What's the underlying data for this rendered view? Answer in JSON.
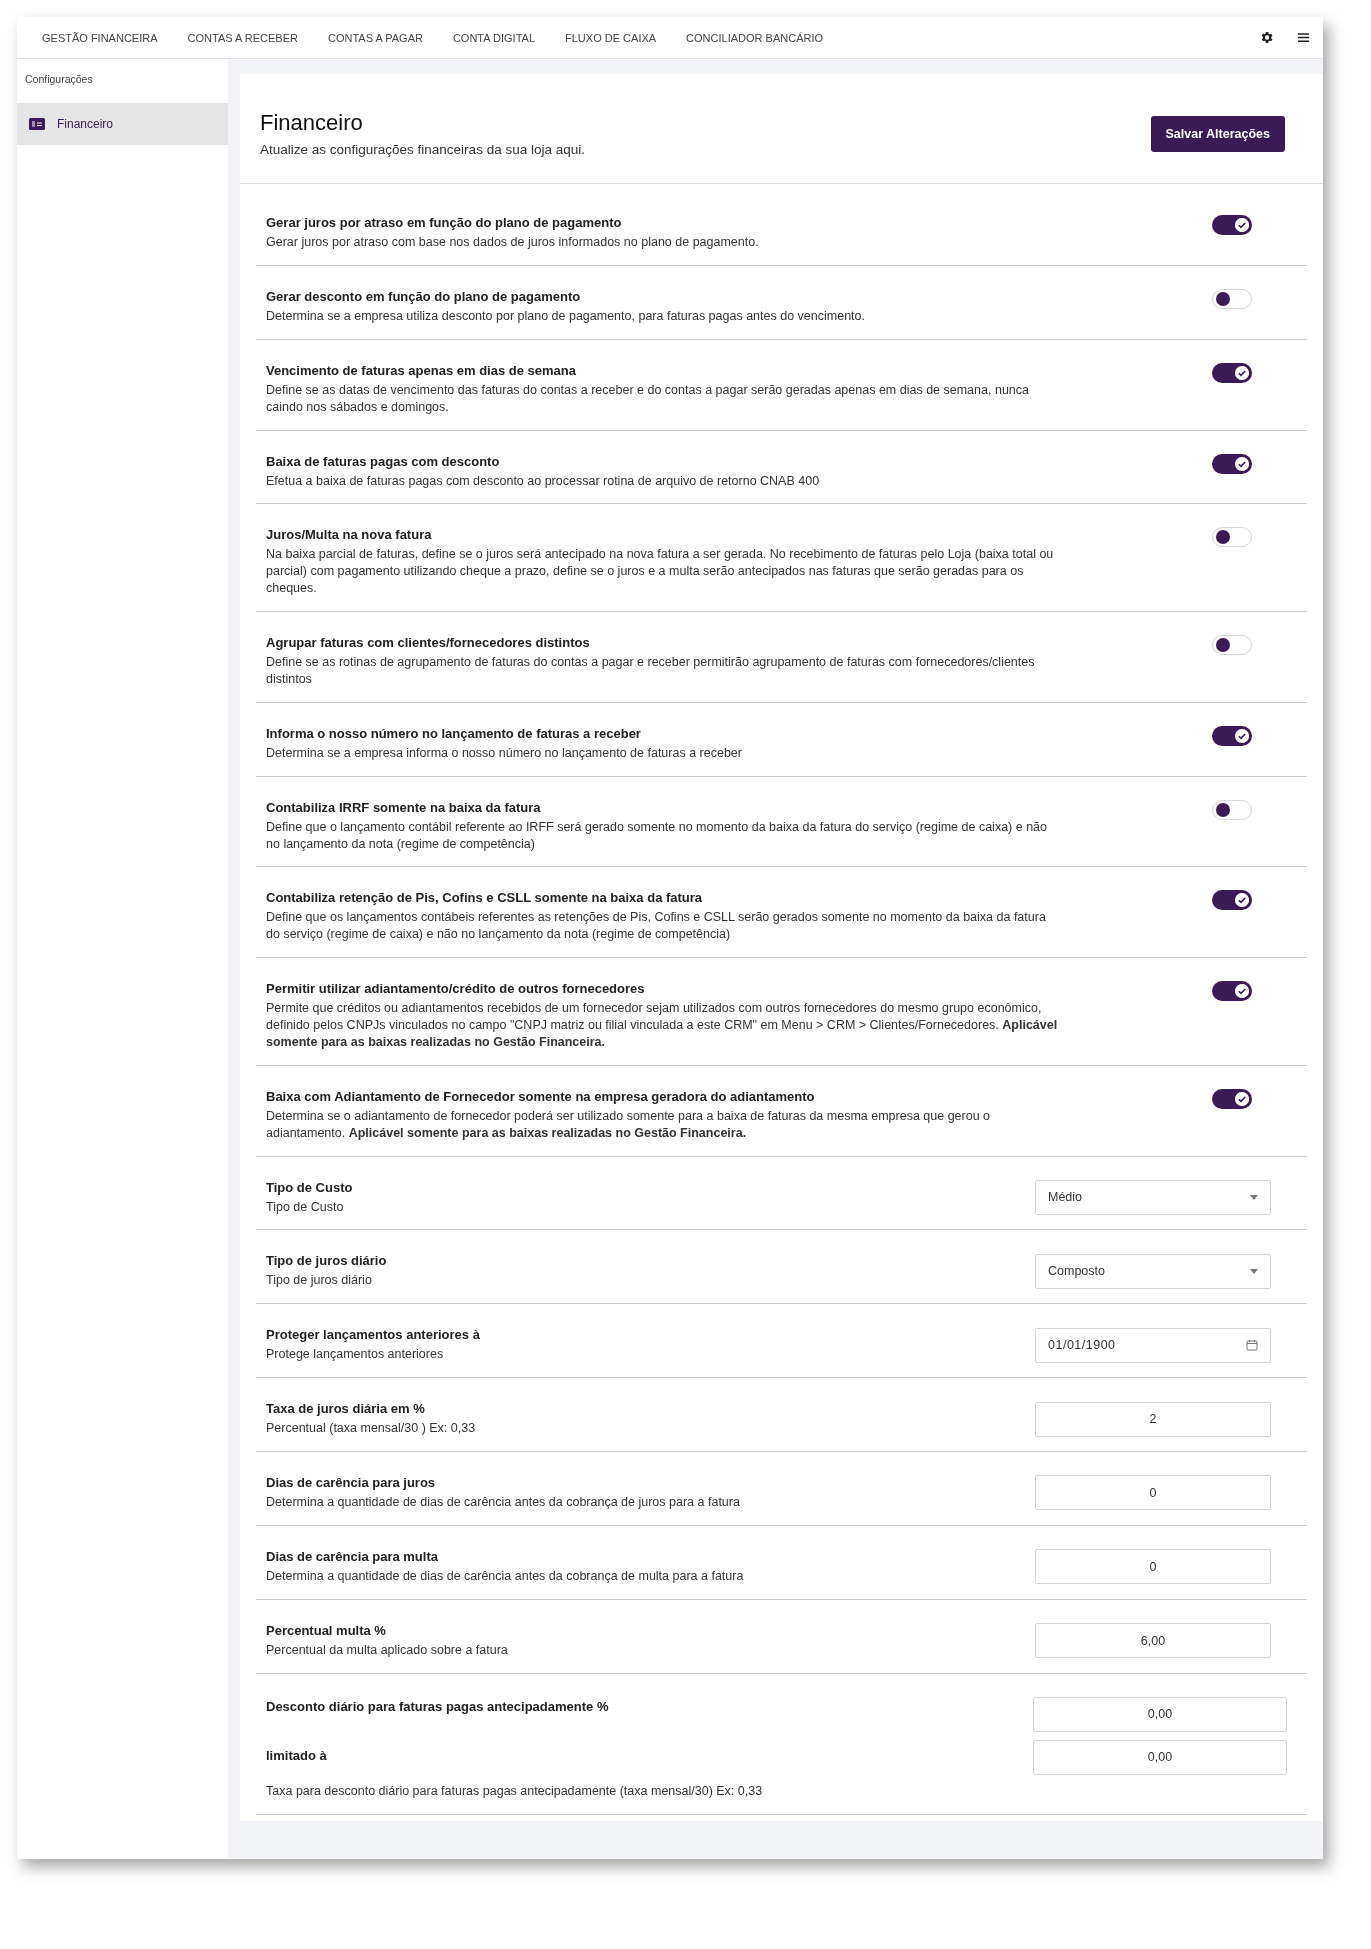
{
  "nav": {
    "tabs": [
      {
        "label": "GESTÃO FINANCEIRA",
        "selected": false
      },
      {
        "label": "CONTAS A RECEBER",
        "selected": false
      },
      {
        "label": "CONTAS A PAGAR",
        "selected": false
      },
      {
        "label": "CONTA DIGITAL",
        "selected": false
      },
      {
        "label": "FLUXO DE CAIXA",
        "selected": false
      },
      {
        "label": "CONCILIADOR BANCÁRIO",
        "selected": false
      }
    ]
  },
  "sidebar": {
    "heading": "Configurações",
    "items": [
      {
        "label": "Financeiro",
        "selected": true
      }
    ]
  },
  "header": {
    "title": "Financeiro",
    "subtitle": "Atualize as configurações financeiras da sua loja aqui.",
    "save_button": "Salvar Alterações"
  },
  "settings": [
    {
      "kind": "toggle",
      "title": "Gerar juros por atraso em função do plano de pagamento",
      "description": "Gerar juros por atraso com base nos dados de juros informados no plano de pagamento.",
      "on": true
    },
    {
      "kind": "toggle",
      "title": "Gerar desconto em função do plano de pagamento",
      "description": "Determina se a empresa utiliza desconto por plano de pagamento, para faturas pagas antes do vencimento.",
      "on": false
    },
    {
      "kind": "toggle",
      "title": "Vencimento de faturas apenas em dias de semana",
      "description": "Define se as datas de vencimento das faturas do contas a receber e do contas a pagar serão geradas apenas em dias de semana, nunca caindo nos sábados e domingos.",
      "on": true
    },
    {
      "kind": "toggle",
      "title": "Baixa de faturas pagas com desconto",
      "description": "Efetua a baixa de faturas pagas com desconto ao processar rotina de arquivo de retorno CNAB 400",
      "on": true
    },
    {
      "kind": "toggle",
      "title": "Juros/Multa na nova fatura",
      "description": "Na baixa parcial de faturas, define se o juros será antecipado na nova fatura a ser gerada. No recebimento de faturas pelo Loja (baixa total ou parcial) com pagamento utilizando cheque a prazo, define se o juros e a multa serão antecipados nas faturas que serão geradas para os cheques.",
      "on": false
    },
    {
      "kind": "toggle",
      "title": "Agrupar faturas com clientes/fornecedores distintos",
      "description": "Define se as rotinas de agrupamento de faturas do contas a pagar e receber permitirão agrupamento de faturas com fornecedores/clientes distintos",
      "on": false
    },
    {
      "kind": "toggle",
      "title": "Informa o nosso número no lançamento de faturas a receber",
      "description": "Determina se a empresa informa o nosso número no lançamento de faturas a receber",
      "on": true
    },
    {
      "kind": "toggle",
      "title": "Contabiliza IRRF somente na baixa da fatura",
      "description": "Define que o lançamento contábil referente ao IRFF será gerado somente no momento da baixa da fatura do serviço (regime de caixa) e não no lançamento da nota (regime de competência)",
      "on": false
    },
    {
      "kind": "toggle",
      "title": "Contabiliza retenção de Pis, Cofins e CSLL somente na baixa da fatura",
      "description": "Define que os lançamentos contábeis referentes as retenções de Pis, Cofins e CSLL serão gerados somente no momento da baixa da fatura do serviço (regime de caixa) e não no lançamento da nota (regime de competência)",
      "on": true
    },
    {
      "kind": "toggle",
      "title": "Permitir utilizar adiantamento/crédito de outros fornecedores",
      "description": "Permite que créditos ou adiantamentos recebidos de um fornecedor sejam utilizados com outros fornecedores do mesmo grupo econômico, definido pelos CNPJs vinculados no campo \"CNPJ matriz ou filial vinculada a este CRM\" em Menu > CRM > Clientes/Fornecedores. **Aplicável somente para as baixas realizadas no Gestão Financeira.**",
      "on": true
    },
    {
      "kind": "toggle",
      "title": "Baixa com Adiantamento de Fornecedor somente na empresa geradora do adiantamento",
      "description": "Determina se o adiantamento de fornecedor poderá ser utilizado somente para a baixa de faturas da mesma empresa que gerou o adiantamento. **Aplicável somente para as baixas realizadas no Gestão Financeira.**",
      "on": true
    },
    {
      "kind": "select",
      "title": "Tipo de Custo",
      "description": "Tipo de Custo",
      "value": "Médio"
    },
    {
      "kind": "select",
      "title": "Tipo de juros diário",
      "description": "Tipo de juros diário",
      "value": "Composto"
    },
    {
      "kind": "date",
      "title": "Proteger lançamentos anteriores à",
      "description": "Protege lançamentos anteriores",
      "value": "01/01/1900"
    },
    {
      "kind": "number",
      "title": "Taxa de juros diária em %",
      "description": "Percentual (taxa mensal/30 ) Ex: 0,33",
      "value": "2"
    },
    {
      "kind": "number",
      "title": "Dias de carência para juros",
      "description": "Determina a quantidade de dias de carência antes da cobrança de juros para a fatura",
      "value": "0"
    },
    {
      "kind": "number",
      "title": "Dias de carência para multa",
      "description": "Determina a quantidade de dias de carência antes da cobrança de multa para a fatura",
      "value": "0"
    },
    {
      "kind": "number",
      "title": "Percentual multa %",
      "description": "Percentual da multa aplicado sobre a fatura",
      "value": "6,00"
    },
    {
      "kind": "pair",
      "title": "Desconto diário para faturas pagas antecipadamente %",
      "value": "0,00",
      "second_title": "limitado à",
      "second_value": "0,00",
      "description": "Taxa para desconto diário para faturas pagas antecipadamente (taxa mensal/30) Ex: 0,33"
    }
  ]
}
